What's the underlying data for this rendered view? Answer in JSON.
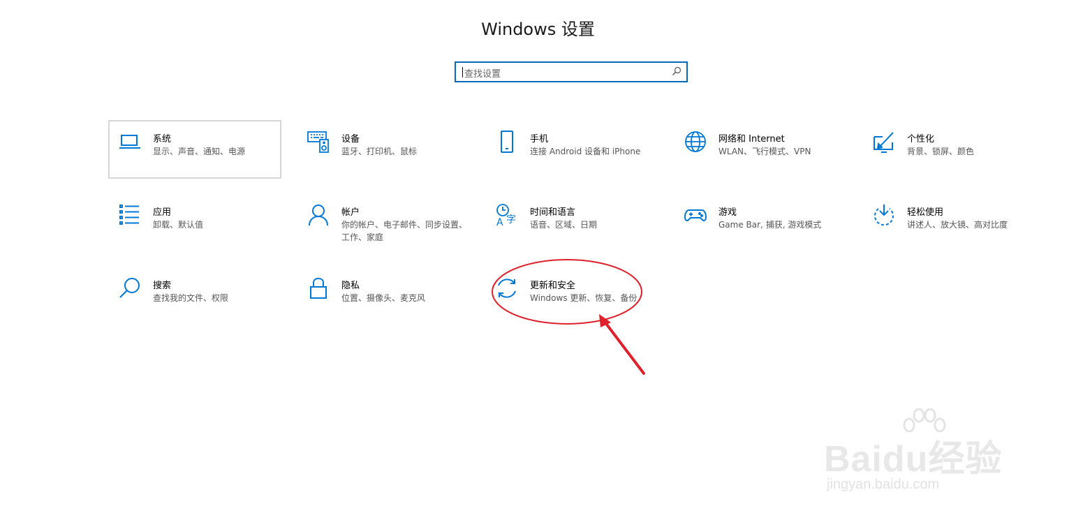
{
  "window": {
    "title": "Windows 设置"
  },
  "search": {
    "placeholder": "查找设置",
    "icon": "search-icon"
  },
  "accent_color": "#0078d7",
  "tiles": [
    {
      "id": "system",
      "label": "系统",
      "desc": "显示、声音、通知、电源",
      "icon": "laptop-icon"
    },
    {
      "id": "devices",
      "label": "设备",
      "desc": "蓝牙、打印机、鼠标",
      "icon": "devices-icon"
    },
    {
      "id": "phone",
      "label": "手机",
      "desc": "连接 Android 设备和 iPhone",
      "icon": "phone-icon"
    },
    {
      "id": "network",
      "label": "网络和 Internet",
      "desc": "WLAN、飞行模式、VPN",
      "icon": "globe-icon"
    },
    {
      "id": "personalization",
      "label": "个性化",
      "desc": "背景、锁屏、颜色",
      "icon": "personalization-icon"
    },
    {
      "id": "apps",
      "label": "应用",
      "desc": "卸载、默认值",
      "icon": "apps-list-icon"
    },
    {
      "id": "accounts",
      "label": "帐户",
      "desc": "你的帐户、电子邮件、同步设置、工作、家庭",
      "icon": "person-icon"
    },
    {
      "id": "time",
      "label": "时间和语言",
      "desc": "语音、区域、日期",
      "icon": "time-language-icon"
    },
    {
      "id": "gaming",
      "label": "游戏",
      "desc": "Game Bar, 捕获, 游戏模式",
      "icon": "gamepad-icon"
    },
    {
      "id": "ease",
      "label": "轻松使用",
      "desc": "讲述人、放大镜、高对比度",
      "icon": "ease-of-access-icon"
    },
    {
      "id": "search",
      "label": "搜索",
      "desc": "查找我的文件、权限",
      "icon": "search-magnifier-icon"
    },
    {
      "id": "privacy",
      "label": "隐私",
      "desc": "位置、摄像头、麦克风",
      "icon": "lock-icon"
    },
    {
      "id": "update",
      "label": "更新和安全",
      "desc": "Windows 更新、恢复、备份",
      "icon": "sync-icon"
    }
  ],
  "annotation": {
    "color": "#e0202a"
  },
  "watermark": {
    "brand": "Baidu经验",
    "site": "jingyan.baidu.com"
  }
}
